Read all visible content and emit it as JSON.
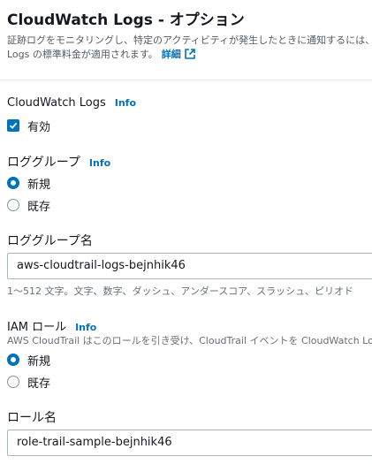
{
  "header": {
    "title": "CloudWatch Logs - オプション",
    "description_line1": "証跡ログをモニタリングし、特定のアクティビティが発生したときに通知するには、CloudTrail を設定して証跡ログを CloudWatch",
    "description_line2": "Logs の標準料金が適用されます。",
    "details_link": "詳細",
    "details_icon": "external-link-icon"
  },
  "cloudwatch_logs": {
    "label": "CloudWatch Logs",
    "info": "Info",
    "enabled_label": "有効",
    "enabled": true
  },
  "log_group": {
    "label": "ロググループ",
    "info": "Info",
    "options": [
      "新規",
      "既存"
    ],
    "selected": "新規"
  },
  "log_group_name": {
    "label": "ロググループ名",
    "value": "aws-cloudtrail-logs-bejnhik46",
    "hint": "1～512 文字。文字、数字、ダッシュ、アンダースコア、スラッシュ、ピリオド"
  },
  "iam_role": {
    "label": "IAM ロール",
    "info": "Info",
    "description": "AWS CloudTrail はこのロールを引き受け、CloudTrail イベントを CloudWatch Logs",
    "options": [
      "新規",
      "既存"
    ],
    "selected": "新規"
  },
  "role_name": {
    "label": "ロール名",
    "value": "role-trail-sample-bejnhik46"
  },
  "colors": {
    "accent": "#0073bb",
    "text": "#16191f",
    "muted": "#545b64",
    "border": "#aab7b8"
  }
}
